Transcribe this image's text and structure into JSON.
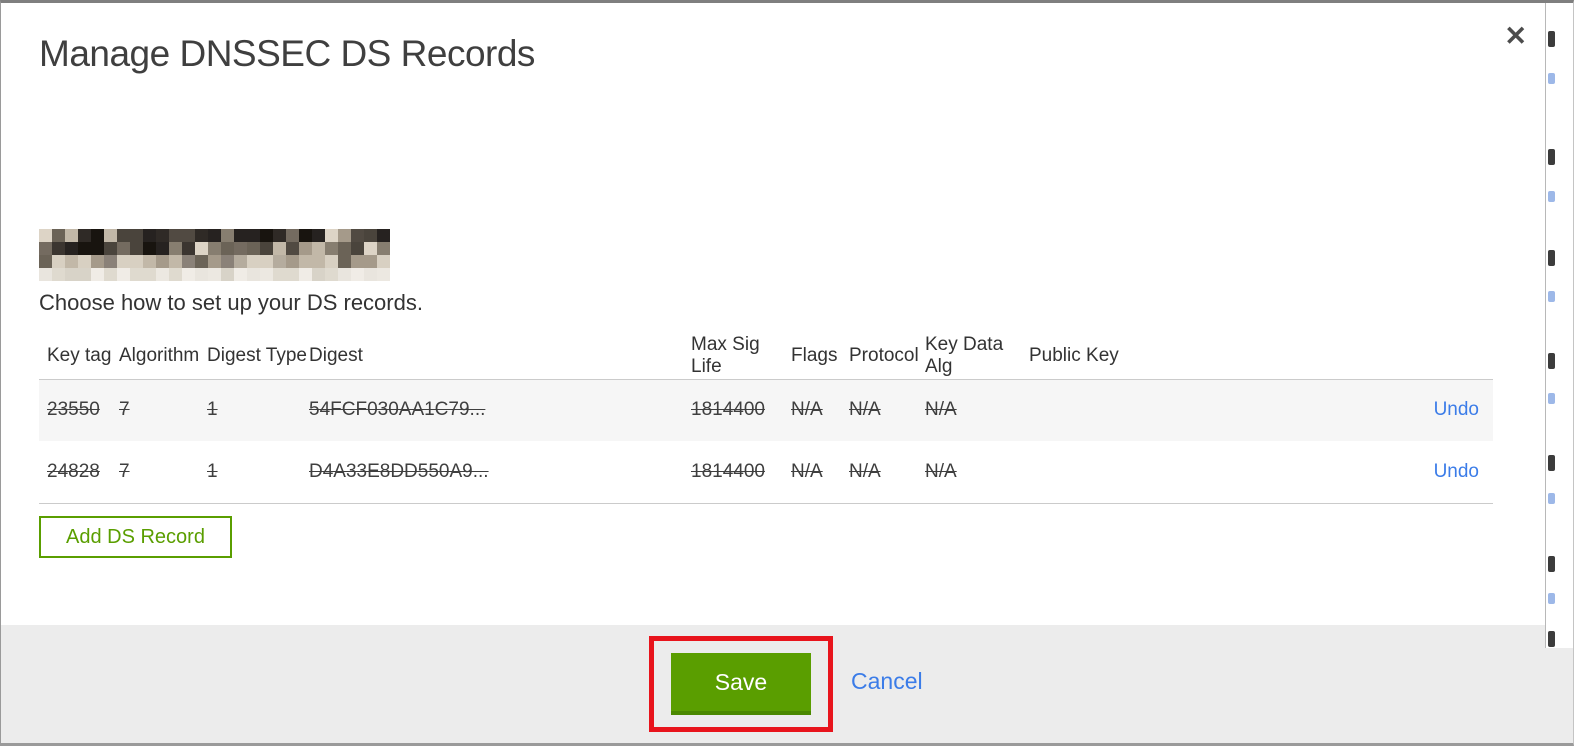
{
  "modal": {
    "title": "Manage DNSSEC DS Records",
    "close_glyph": "✕",
    "subtitle": "Choose how to set up your DS records.",
    "table": {
      "headers": [
        "Key tag",
        "Algorithm",
        "Digest Type",
        "Digest",
        "Max Sig Life",
        "Flags",
        "Protocol",
        "Key Data Alg",
        "Public Key"
      ],
      "rows": [
        {
          "key_tag": "23550",
          "algorithm": "7",
          "digest_type": "1",
          "digest": "54FCF030AA1C79...",
          "max_sig_life": "1814400",
          "flags": "N/A",
          "protocol": "N/A",
          "key_data_alg": "N/A",
          "public_key": "",
          "action": "Undo",
          "deleted": true
        },
        {
          "key_tag": "24828",
          "algorithm": "7",
          "digest_type": "1",
          "digest": "D4A33E8DD550A9...",
          "max_sig_life": "1814400",
          "flags": "N/A",
          "protocol": "N/A",
          "key_data_alg": "N/A",
          "public_key": "",
          "action": "Undo",
          "deleted": true
        }
      ]
    },
    "add_button_label": "Add DS Record",
    "footer": {
      "save_label": "Save",
      "cancel_label": "Cancel"
    }
  },
  "colors": {
    "green": "#5a9e00",
    "green_dark": "#4a8800",
    "link_blue": "#3b7ce8",
    "annotation_red": "#e8141c",
    "footer_bg": "#ececec",
    "row_alt_bg": "#f6f6f6",
    "border_gray": "#cbcbcb"
  }
}
